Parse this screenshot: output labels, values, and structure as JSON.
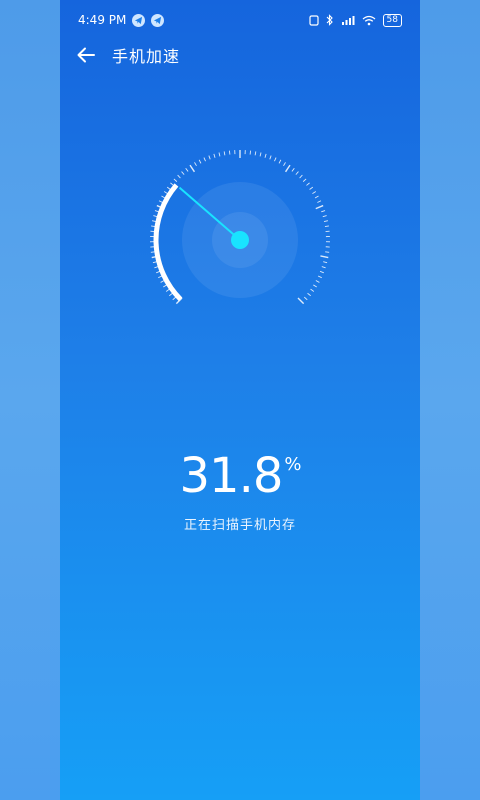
{
  "status_bar": {
    "time": "4:49 PM",
    "battery": "58",
    "icons": [
      "telegram-icon",
      "telegram-icon",
      "sim-icon",
      "bluetooth-icon",
      "signal-icon",
      "wifi-icon",
      "battery-icon"
    ]
  },
  "header": {
    "title": "手机加速"
  },
  "gauge": {
    "percent": 31.8
  },
  "result": {
    "value": "31.8",
    "unit": "%",
    "caption": "正在扫描手机内存"
  },
  "colors": {
    "top": "#1565dd",
    "bottom": "#169ff6",
    "needle": "#19e3ff",
    "ticks": "#ffffff"
  }
}
